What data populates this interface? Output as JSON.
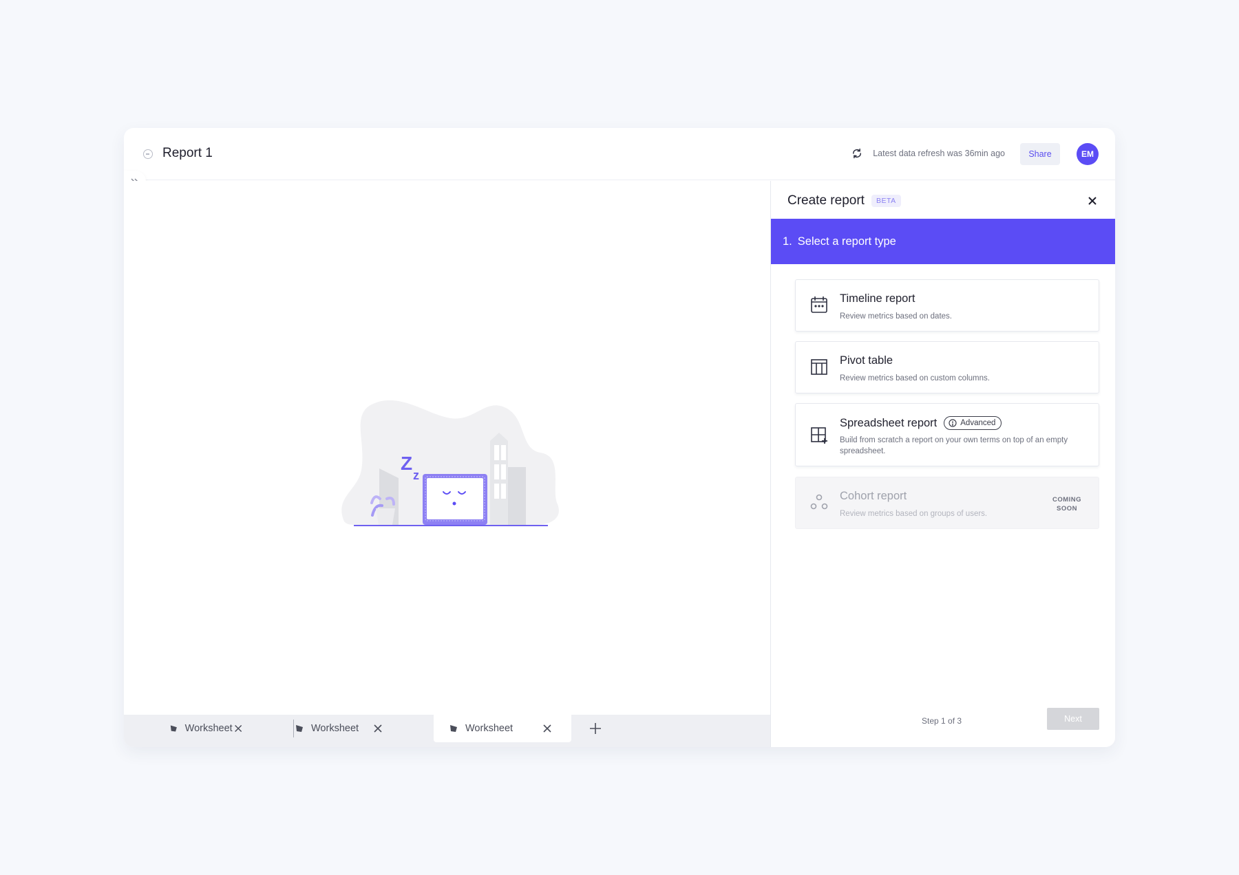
{
  "header": {
    "title": "Report 1",
    "refresh_text": "Latest data refresh was 36min ago",
    "share_label": "Share",
    "avatar_initials": "EM"
  },
  "tabs": [
    {
      "label": "Worksheet",
      "active": false
    },
    {
      "label": "Worksheet",
      "active": false
    },
    {
      "label": "Worksheet",
      "active": true
    }
  ],
  "panel": {
    "title": "Create report",
    "badge": "BETA",
    "step_number": "1.",
    "step_title": "Select a report type",
    "options": [
      {
        "title": "Timeline report",
        "description": "Review metrics based on dates.",
        "icon": "calendar-icon"
      },
      {
        "title": "Pivot table",
        "description": "Review metrics based on custom columns.",
        "icon": "table-icon"
      },
      {
        "title": "Spreadsheet report",
        "badge": "Advanced",
        "description": "Build from scratch a report on your own terms on top of an empty spreadsheet.",
        "icon": "grid-plus-icon"
      },
      {
        "title": "Cohort report",
        "description": "Review metrics based on groups of users.",
        "icon": "cohort-icon",
        "status_line1": "COMING",
        "status_line2": "SOON",
        "disabled": true
      }
    ],
    "step_indicator": "Step 1 of 3",
    "next_label": "Next"
  },
  "illustration": {
    "sleep_big": "Z",
    "sleep_small": "z"
  },
  "colors": {
    "accent": "#5b4cf5",
    "background": "#f6f8fc",
    "illustration_gray": "#e4e5e9"
  }
}
